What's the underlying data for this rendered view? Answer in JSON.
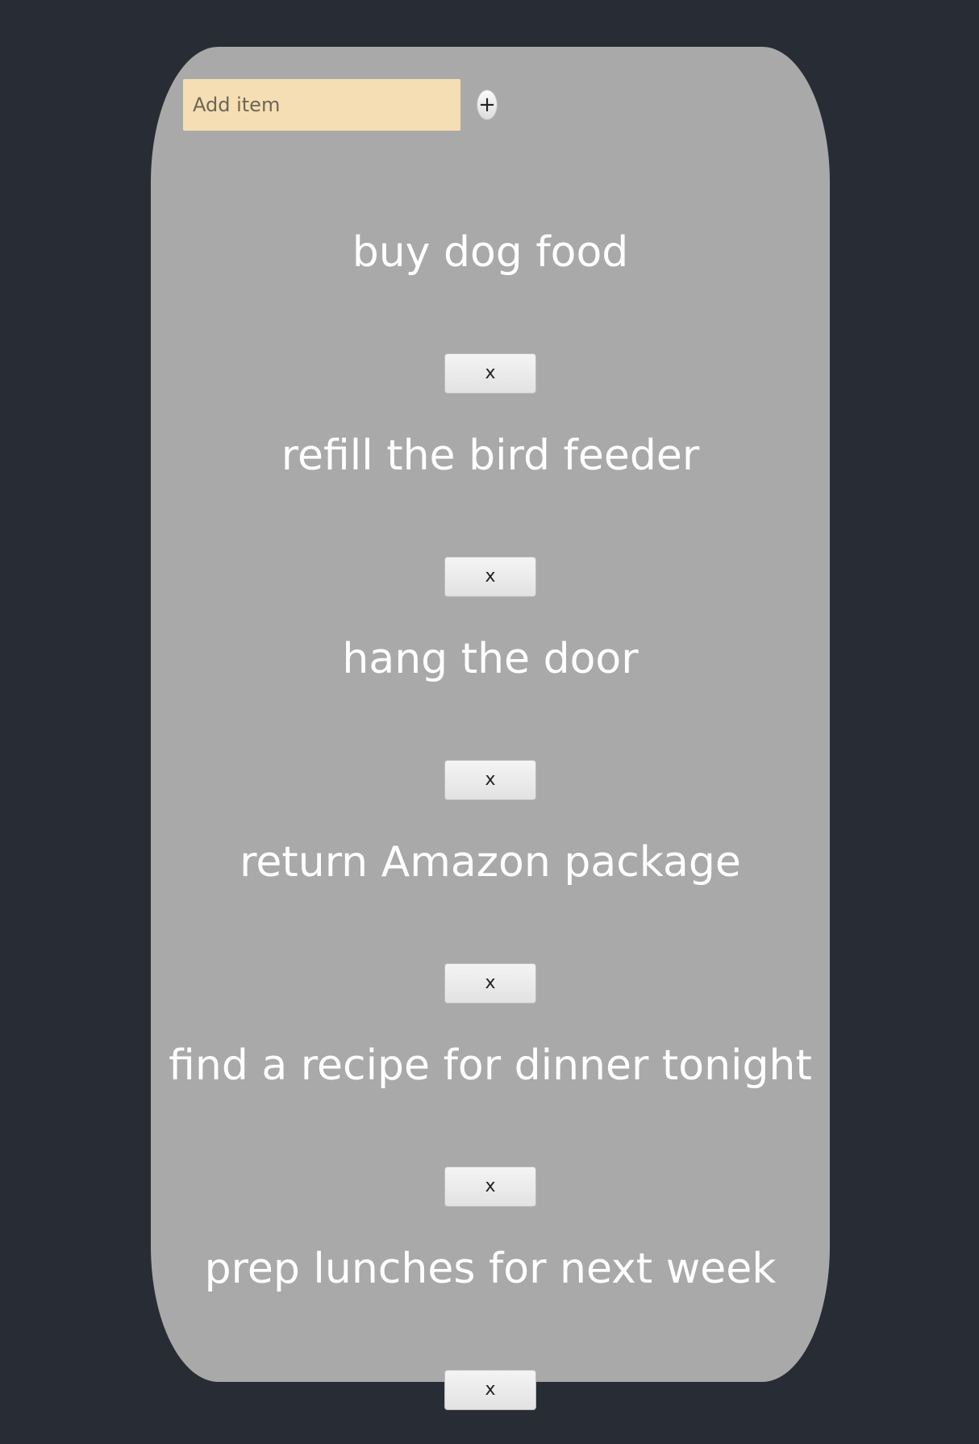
{
  "add_form": {
    "placeholder": "Add item",
    "value": "",
    "add_button_label": "+"
  },
  "items": [
    {
      "text": "buy dog food",
      "remove_label": "x"
    },
    {
      "text": "refill the bird feeder",
      "remove_label": "x"
    },
    {
      "text": "hang the door",
      "remove_label": "x"
    },
    {
      "text": "return Amazon package",
      "remove_label": "x"
    },
    {
      "text": "find a recipe for dinner tonight",
      "remove_label": "x"
    },
    {
      "text": "prep lunches for next week",
      "remove_label": "x"
    }
  ],
  "colors": {
    "page_background": "#282c35",
    "card_background": "#a9a9a9",
    "input_background": "#f5deb3",
    "item_text": "#ffffff"
  }
}
